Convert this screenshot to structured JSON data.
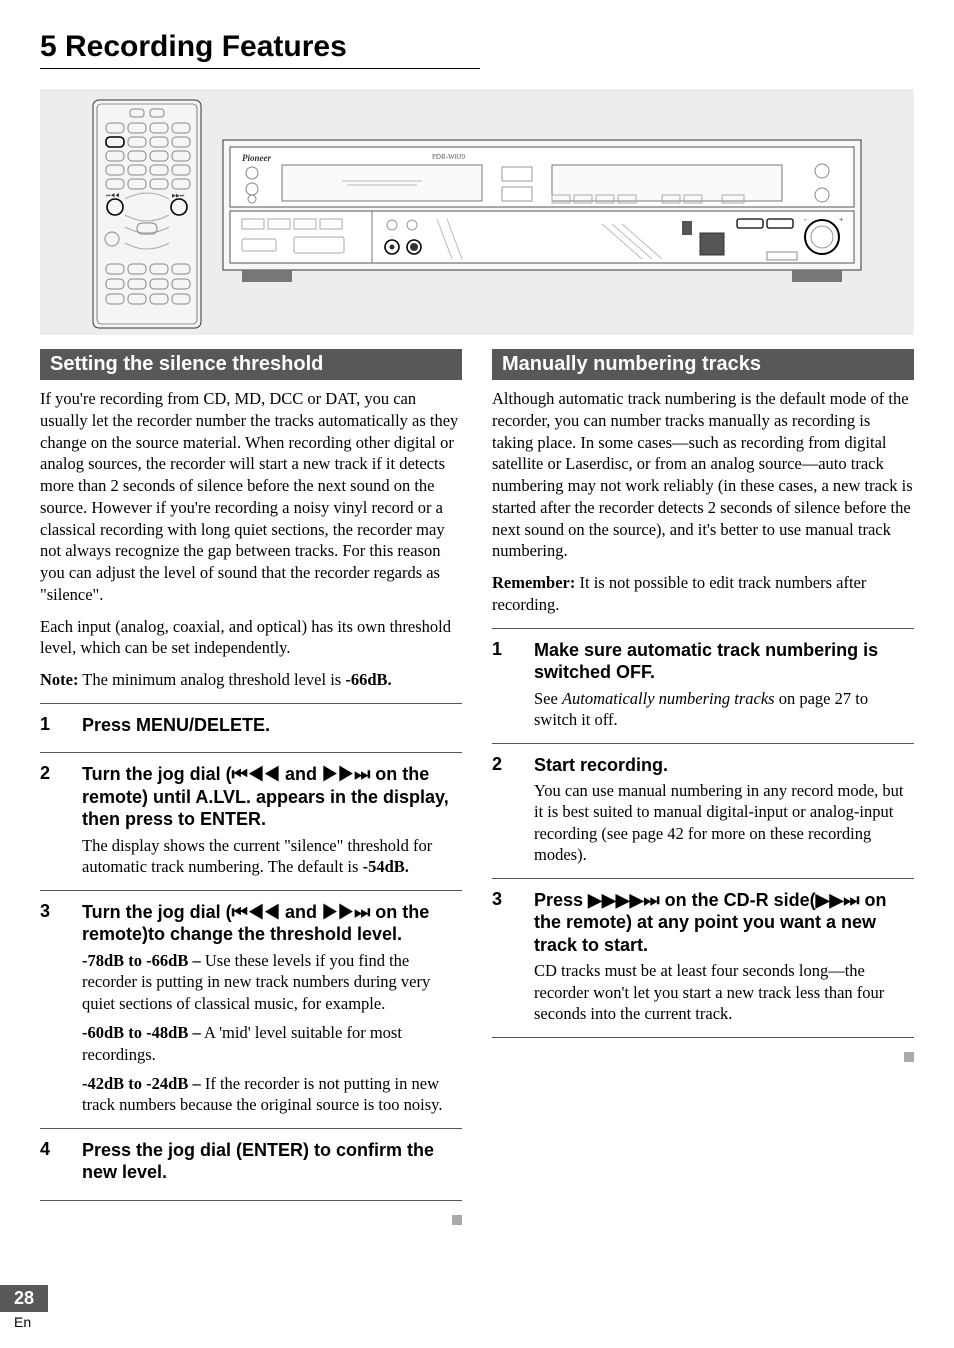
{
  "page_title": "5 Recording Features",
  "left": {
    "header": "Setting the silence threshold",
    "p1": "If you're recording from CD, MD, DCC or DAT, you can usually let the recorder number the tracks automatically as they change on the source material. When recording other digital or analog sources, the recorder will start a new track if it detects more than 2 seconds of silence before the next sound on the source. However if you're recording a noisy vinyl record or a classical recording with long quiet sections, the recorder may not always recognize the gap between tracks. For this reason you can adjust the level of sound that the recorder regards as \"silence\".",
    "p2": "Each input (analog, coaxial, and optical) has its own threshold level, which can be set independently.",
    "note_label": "Note:",
    "note_text": " The minimum analog threshold level is ",
    "note_value": "-66dB.",
    "steps": [
      {
        "num": "1",
        "head": "Press MENU/DELETE."
      },
      {
        "num": "2",
        "head": "Turn the jog dial (⏮◀◀ and ▶▶⏭ on the remote) until A.LVL. appears in the display, then press to ENTER.",
        "desc_pre": "The display shows the current \"silence\" threshold for automatic track numbering. The default is ",
        "desc_bold": "-54dB."
      },
      {
        "num": "3",
        "head": "Turn the jog dial (⏮◀◀ and ▶▶⏭ on the remote)to change the threshold level.",
        "b1_label": "-78dB to -66dB –",
        "b1_text": " Use these levels if you find the recorder is putting in new track numbers during very quiet sections of classical music, for example.",
        "b2_label": "-60dB to -48dB –",
        "b2_text": " A 'mid' level suitable for most recordings.",
        "b3_label": "-42dB to -24dB –",
        "b3_text": " If the recorder is not putting in new track numbers because the original source is too noisy."
      },
      {
        "num": "4",
        "head": "Press the jog dial (ENTER) to confirm the new level."
      }
    ]
  },
  "right": {
    "header": "Manually numbering tracks",
    "p1": "Although automatic track numbering is the default mode of the recorder, you can number tracks manually as recording is taking place. In some cases—such as recording from digital satellite or Laserdisc, or from an analog source—auto track numbering may not work reliably (in these cases, a new track is started after the recorder detects 2 seconds of silence before the next sound on the source), and it's better to use manual track numbering.",
    "remember_label": "Remember:",
    "remember_text": " It is not possible to edit track numbers after recording.",
    "steps": [
      {
        "num": "1",
        "head": "Make sure automatic track numbering is switched OFF.",
        "desc_pre": "See ",
        "desc_italic": "Automatically numbering tracks",
        "desc_post": " on page 27 to switch it off."
      },
      {
        "num": "2",
        "head": "Start recording.",
        "desc": "You can use manual numbering in any record mode, but it is best suited to manual digital-input or analog-input recording (see page 42 for more on these recording modes)."
      },
      {
        "num": "3",
        "head": "Press ▶▶▶▶⏭ on the CD-R side(▶▶⏭ on the remote) at any point you want a new track to start.",
        "desc": "CD tracks must be at least four seconds long—the recorder won't let you start a new track less than four seconds into the current track."
      }
    ]
  },
  "device_model": "PDR-W839",
  "brand": "Pioneer",
  "page_number": "28",
  "lang": "En"
}
